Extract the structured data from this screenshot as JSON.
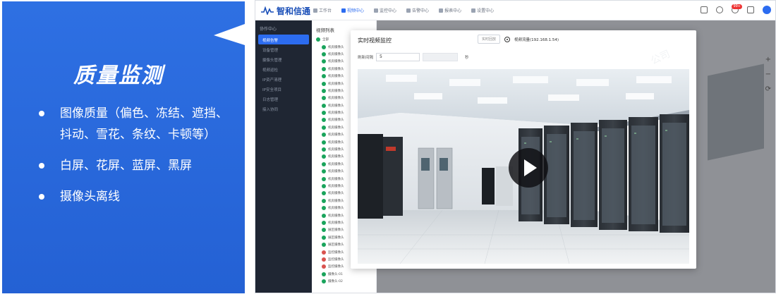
{
  "callout": {
    "title": "质量监测",
    "bullets": [
      "图像质量（偏色、冻结、遮挡、抖动、雪花、条纹、卡顿等）",
      "白屏、花屏、蓝屏、黑屏",
      "摄像头离线"
    ],
    "color": "#2b6bdf"
  },
  "app": {
    "logo_text": "智和信通",
    "nav": [
      "工作台",
      "视频中心",
      "监控中心",
      "告警中心",
      "报表中心",
      "设置中心"
    ],
    "active_nav_index": 1,
    "notification_count": "99+",
    "sidebar_header": "协作中心",
    "sidebar_items": [
      "视频告警",
      "设备管理",
      "摄像头管理",
      "视频巡检",
      "IP资产清理",
      "IP安全项目",
      "日志管理",
      "接入协同"
    ],
    "sidebar_active_index": 0,
    "tree_title": "视频列表",
    "tree_root": "全部",
    "tree_rows": [
      "机房摄像头",
      "机房摄像头",
      "机房摄像头",
      "机房摄像头",
      "机房摄像头",
      "机房摄像头",
      "机房摄像头",
      "机房摄像头",
      "机房摄像头",
      "机房摄像头",
      "机房摄像头",
      "机房摄像头",
      "机房摄像头",
      "机房摄像头",
      "机房摄像头",
      "机房摄像头",
      "机房摄像头",
      "机房摄像头",
      "机房摄像头",
      "机房摄像头",
      "机房摄像头",
      "机房摄像头",
      "机房摄像头",
      "机房摄像头",
      "机房摄像头",
      "展区摄像头",
      "展区摄像头",
      "展区摄像头",
      "监控摄像头",
      "监控摄像头",
      "监控摄像头",
      "摄像头-01",
      "摄像头-02"
    ],
    "tree_alert_rows": [
      28,
      29,
      30
    ]
  },
  "modal": {
    "title": "实时视频监控",
    "tab_button": "实时回放",
    "source_label": "视频流量(192.168.1.54)",
    "interval_label": "刷新间隔",
    "interval_value": "5",
    "interval_unit": "秒"
  },
  "colors": {
    "accent": "#2c6cf0",
    "sidebar_bg": "#1f2633",
    "ok": "#1aa45c",
    "alert": "#d9534f"
  }
}
